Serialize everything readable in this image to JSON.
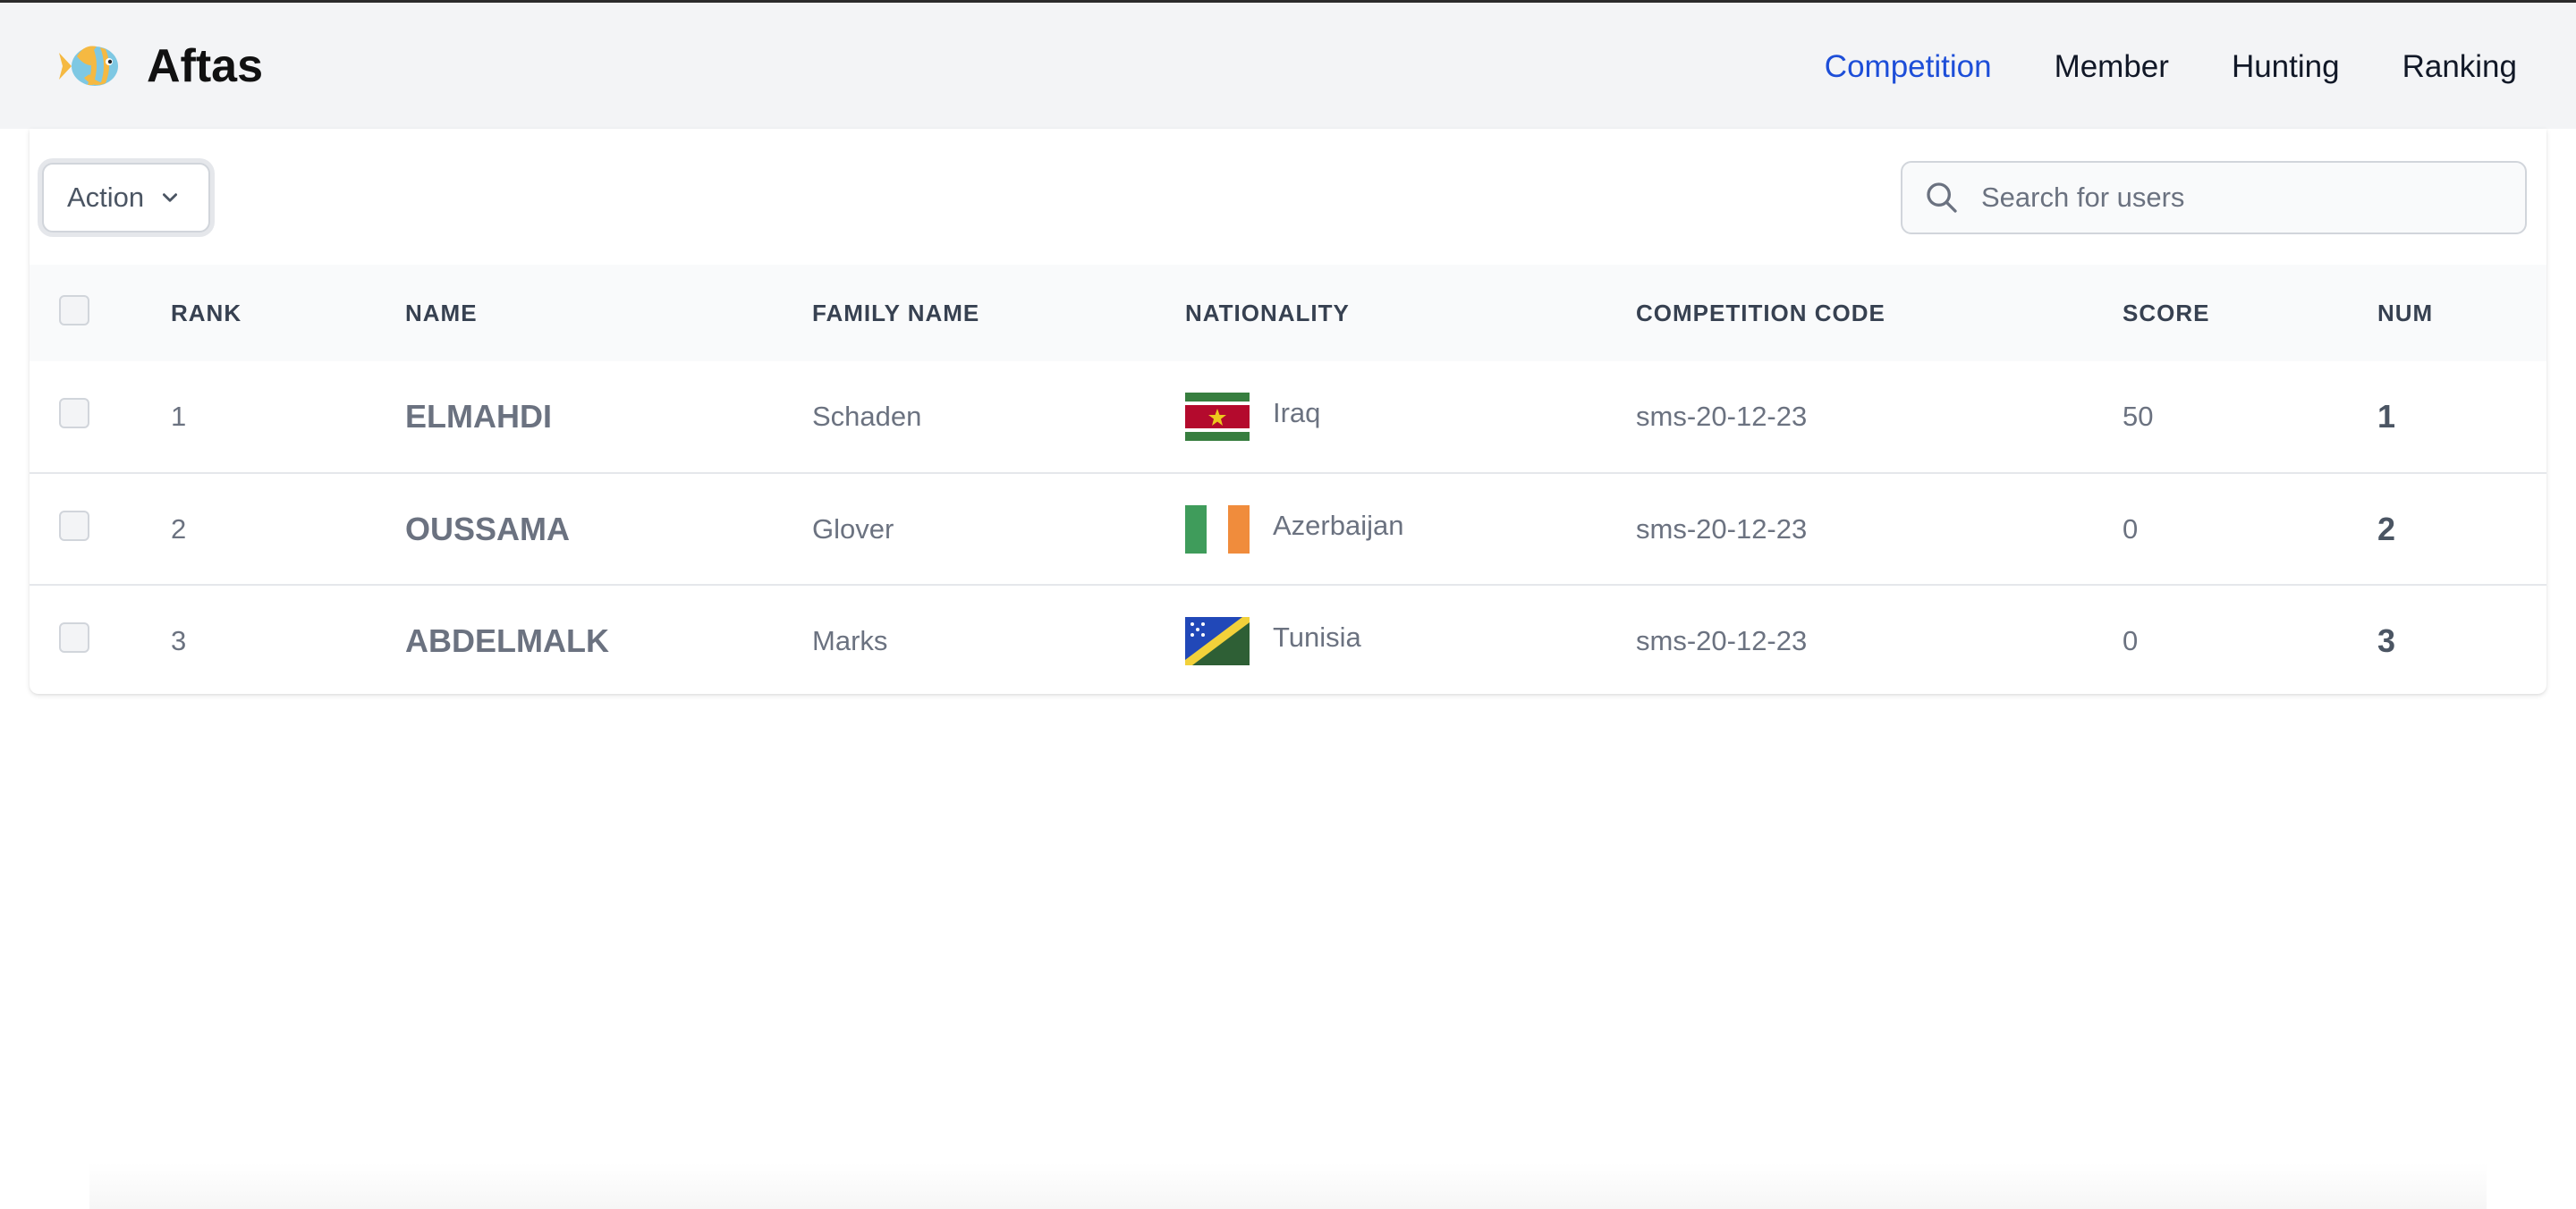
{
  "app": {
    "brand": "Aftas",
    "logo_icon": "fish-icon"
  },
  "nav": {
    "items": [
      {
        "label": "Competition",
        "active": true
      },
      {
        "label": "Member",
        "active": false
      },
      {
        "label": "Hunting",
        "active": false
      },
      {
        "label": "Ranking",
        "active": false
      }
    ]
  },
  "toolbar": {
    "action_label": "Action",
    "search_placeholder": "Search for users"
  },
  "table": {
    "headers": [
      "Rank",
      "Name",
      "Family Name",
      "Nationality",
      "Competition Code",
      "Score",
      "Num"
    ],
    "rows": [
      {
        "rank": "1",
        "name": "ELMAHDI",
        "family_name": "Schaden",
        "nationality": "Iraq",
        "flag": "suriname-like-flag",
        "competition_code": "sms-20-12-23",
        "score": "50",
        "num": "1"
      },
      {
        "rank": "2",
        "name": "OUSSAMA",
        "family_name": "Glover",
        "nationality": "Azerbaijan",
        "flag": "ireland-like-flag",
        "competition_code": "sms-20-12-23",
        "score": "0",
        "num": "2"
      },
      {
        "rank": "3",
        "name": "ABDELMALK",
        "family_name": "Marks",
        "nationality": "Tunisia",
        "flag": "solomon-islands-like-flag",
        "competition_code": "sms-20-12-23",
        "score": "0",
        "num": "3"
      }
    ]
  },
  "colors": {
    "active_nav": "#1d4ed8",
    "navbar_bg": "#f3f4f6",
    "table_header_bg": "#f9fafb"
  }
}
